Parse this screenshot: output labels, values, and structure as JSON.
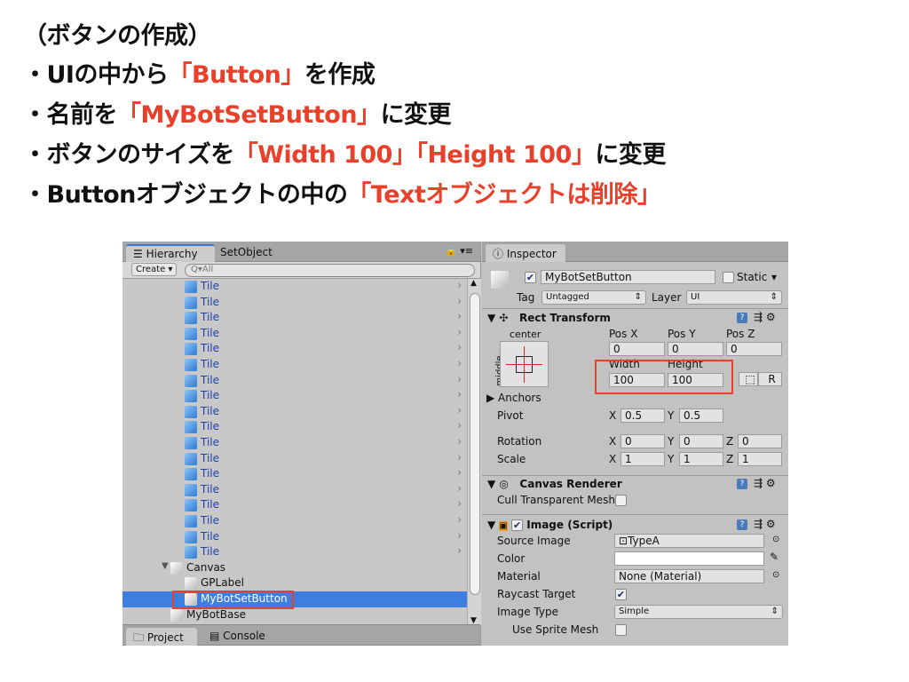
{
  "slide": {
    "heading": "（ボタンの作成）",
    "bullets": [
      {
        "pre": "・UIの中から",
        "em": "「Button」",
        "post": "を作成"
      },
      {
        "pre": "・名前を",
        "em": "「MyBotSetButton」",
        "post": "に変更"
      },
      {
        "pre": "・ボタンのサイズを",
        "em": "「Width 100」「Height 100」",
        "post": "に変更"
      },
      {
        "pre": "・Buttonオブジェクトの中の",
        "em": "「Textオブジェクトは削除」",
        "post": ""
      }
    ],
    "accent_color": "#e8402a"
  },
  "hierarchy": {
    "tabs": [
      "☰ Hierarchy",
      "SetObject"
    ],
    "create_label": "Create ▾",
    "search_placeholder": "Q▾All",
    "tile_label": "Tile",
    "tile_count": 18,
    "items": [
      {
        "label": "▼",
        "name": "Canvas"
      },
      {
        "name": "GPLabel"
      },
      {
        "name": "MyBotSetButton",
        "selected": true
      },
      {
        "name": "MyBotBase"
      }
    ],
    "bottom_tabs": [
      "Project",
      "Console"
    ]
  },
  "inspector": {
    "tab": "Inspector",
    "object_name": "MyBotSetButton",
    "active": true,
    "static_label": "Static",
    "tag_label": "Tag",
    "tag_value": "Untagged",
    "layer_label": "Layer",
    "layer_value": "UI",
    "rect_transform": {
      "title": "Rect Transform",
      "anchor_h": "center",
      "anchor_v": "middle",
      "pos_labels": [
        "Pos X",
        "Pos Y",
        "Pos Z"
      ],
      "pos_values": [
        "0",
        "0",
        "0"
      ],
      "size_labels": [
        "Width",
        "Height"
      ],
      "size_values": [
        "100",
        "100"
      ],
      "r_button": "R",
      "anchors": "Anchors",
      "pivot_label": "Pivot",
      "pivot": [
        "0.5",
        "0.5"
      ],
      "rotation_label": "Rotation",
      "rotation": [
        "0",
        "0",
        "0"
      ],
      "scale_label": "Scale",
      "scale": [
        "1",
        "1",
        "1"
      ],
      "axes": [
        "X",
        "Y",
        "Z"
      ]
    },
    "canvas_renderer": {
      "title": "Canvas Renderer",
      "cull_label": "Cull Transparent Mesh",
      "cull": false
    },
    "image": {
      "title": "Image (Script)",
      "source_label": "Source Image",
      "source_value": "TypeA",
      "color_label": "Color",
      "color_value": "#ffffff",
      "material_label": "Material",
      "material_value": "None (Material)",
      "raycast_label": "Raycast Target",
      "raycast": true,
      "type_label": "Image Type",
      "type_value": "Simple",
      "sprite_mesh_label": "Use Sprite Mesh",
      "sprite_mesh": false
    }
  }
}
